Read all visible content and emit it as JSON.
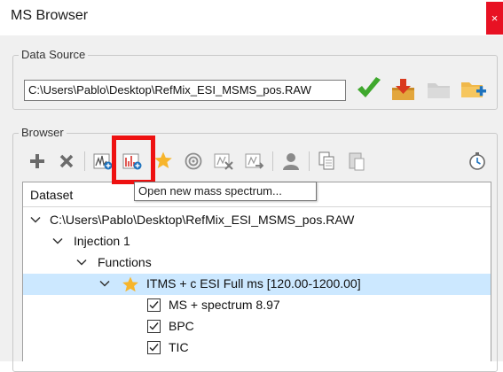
{
  "window": {
    "title": "MS Browser",
    "close_glyph": "×"
  },
  "data_source": {
    "legend": "Data Source",
    "path_value": "C:\\Users\\Pablo\\Desktop\\RefMix_ESI_MSMS_pos.RAW",
    "icons": [
      "confirm-checkmark-icon",
      "import-download-icon",
      "open-folder-icon",
      "add-folder-icon"
    ]
  },
  "browser": {
    "legend": "Browser",
    "toolbar_icons": [
      "add-icon",
      "remove-icon",
      "spectrum-add-icon",
      "open-new-mass-spectrum-icon",
      "favorite-star-icon",
      "target-icon",
      "remove-spectrum-icon",
      "export-spectrum-icon",
      "users-icon",
      "copy-icon",
      "paste-icon",
      "timer-icon"
    ],
    "tooltip": "Open new mass spectrum...",
    "highlight_color": "#ee1111"
  },
  "tree": {
    "header": "Dataset",
    "rows": [
      {
        "label": "C:\\Users\\Pablo\\Desktop\\RefMix_ESI_MSMS_pos.RAW",
        "expanded": true
      },
      {
        "label": "Injection 1",
        "expanded": true
      },
      {
        "label": "Functions",
        "expanded": true
      },
      {
        "label": "ITMS + c ESI Full ms [120.00-1200.00]",
        "expanded": true,
        "selected": true,
        "starred": true
      },
      {
        "label": "MS + spectrum 8.97",
        "checked": true
      },
      {
        "label": "BPC",
        "checked": true
      },
      {
        "label": "TIC",
        "checked": true
      }
    ]
  },
  "colors": {
    "selection": "#cce8ff",
    "close_button": "#e81123",
    "accent_star": "#f7b52b",
    "check_green": "#3fa82d"
  }
}
